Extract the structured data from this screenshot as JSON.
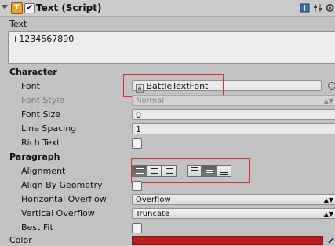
{
  "component": {
    "title": "Text (Script)",
    "enabled": true,
    "icons": [
      "book-icon",
      "sliders-icon",
      "gear-icon"
    ]
  },
  "text": {
    "label": "Text",
    "value": "+1234567890"
  },
  "character": {
    "section": "Character",
    "font": {
      "label": "Font",
      "value": "BattleTextFont"
    },
    "font_style": {
      "label": "Font Style",
      "value": "Normal"
    },
    "font_size": {
      "label": "Font Size",
      "value": "0"
    },
    "line_spacing": {
      "label": "Line Spacing",
      "value": "1"
    },
    "rich_text": {
      "label": "Rich Text",
      "checked": false
    }
  },
  "paragraph": {
    "section": "Paragraph",
    "alignment": {
      "label": "Alignment",
      "horizontal": "left",
      "vertical": "middle"
    },
    "align_by_geometry": {
      "label": "Align By Geometry",
      "checked": false
    },
    "horizontal_overflow": {
      "label": "Horizontal Overflow",
      "value": "Overflow"
    },
    "vertical_overflow": {
      "label": "Vertical Overflow",
      "value": "Truncate"
    },
    "best_fit": {
      "label": "Best Fit",
      "checked": false
    }
  },
  "color": {
    "label": "Color",
    "value": "#b81f1a"
  }
}
